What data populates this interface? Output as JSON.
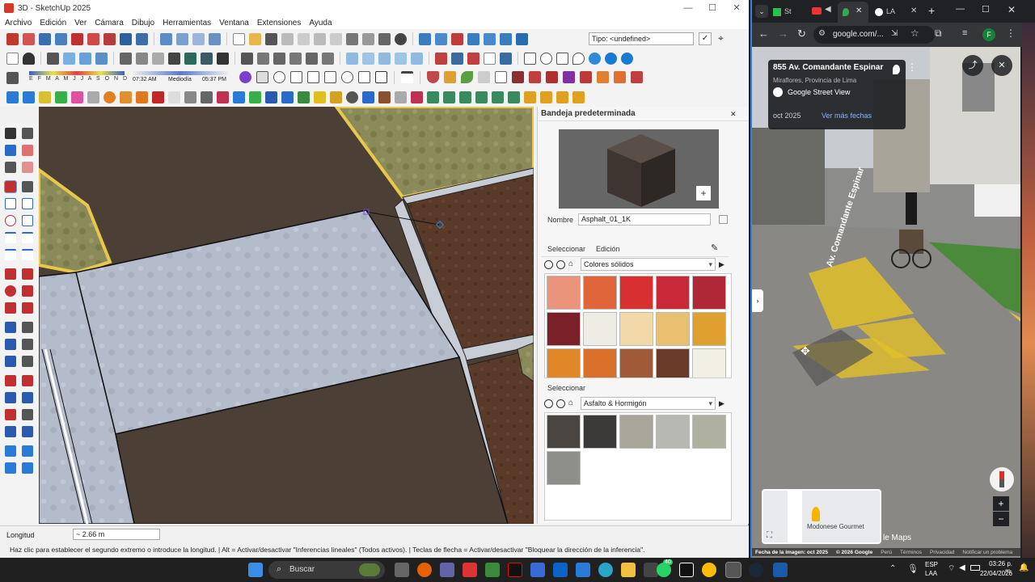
{
  "sketchup": {
    "title": "3D - SketchUp 2025",
    "menu": [
      "Archivo",
      "Edición",
      "Ver",
      "Cámara",
      "Dibujo",
      "Herramientas",
      "Ventana",
      "Extensiones",
      "Ayuda"
    ],
    "tipo_field": "Tipo: <undefined>",
    "months": "E F M A M J J A S O N D",
    "time_start": "07:32 AM",
    "time_mid": "Mediodía",
    "time_end": "05:37 PM",
    "tray": {
      "title": "Bandeja predeterminada",
      "name_label": "Nombre",
      "name_value": "Asphalt_01_1K",
      "tab_select": "Seleccionar",
      "tab_edit": "Edición",
      "collection1": "Colores sólidos",
      "select2": "Seleccionar",
      "collection2": "Asfalto & Hormigón"
    },
    "status": {
      "length_label": "Longitud",
      "length_value": "~ 2.66 m",
      "hint": "Haz clic para establecer el segundo extremo o introduce la longitud. | Alt = Activar/desactivar \"Inferencias lineales\" (Todos activos). | Teclas de flecha = Activar/desactivar \"Bloquear la dirección de la inferencia\"."
    }
  },
  "browser": {
    "tabs": [
      "St",
      "LA"
    ],
    "url": "google.com/...",
    "profile": "F",
    "address": "855 Av. Comandante Espinar",
    "locality": "Miraflores, Provincia de Lima",
    "source": "Google Street View",
    "date": "oct 2025",
    "more_dates": "Ver más fechas",
    "street_sign": "Av. Comandante Espinar",
    "minimap_label": "Modonese Gourmet",
    "maps_label": "le Maps",
    "footer": [
      "Fecha de la imagen: oct 2025",
      "© 2026 Google",
      "Perú",
      "Términos",
      "Privacidad",
      "Notificar un problema"
    ]
  },
  "taskbar": {
    "search": "Buscar",
    "lang1": "ESP",
    "lang2": "LAA",
    "time": "03:26 p. m.",
    "date": "22/04/2026",
    "badge": "40"
  }
}
